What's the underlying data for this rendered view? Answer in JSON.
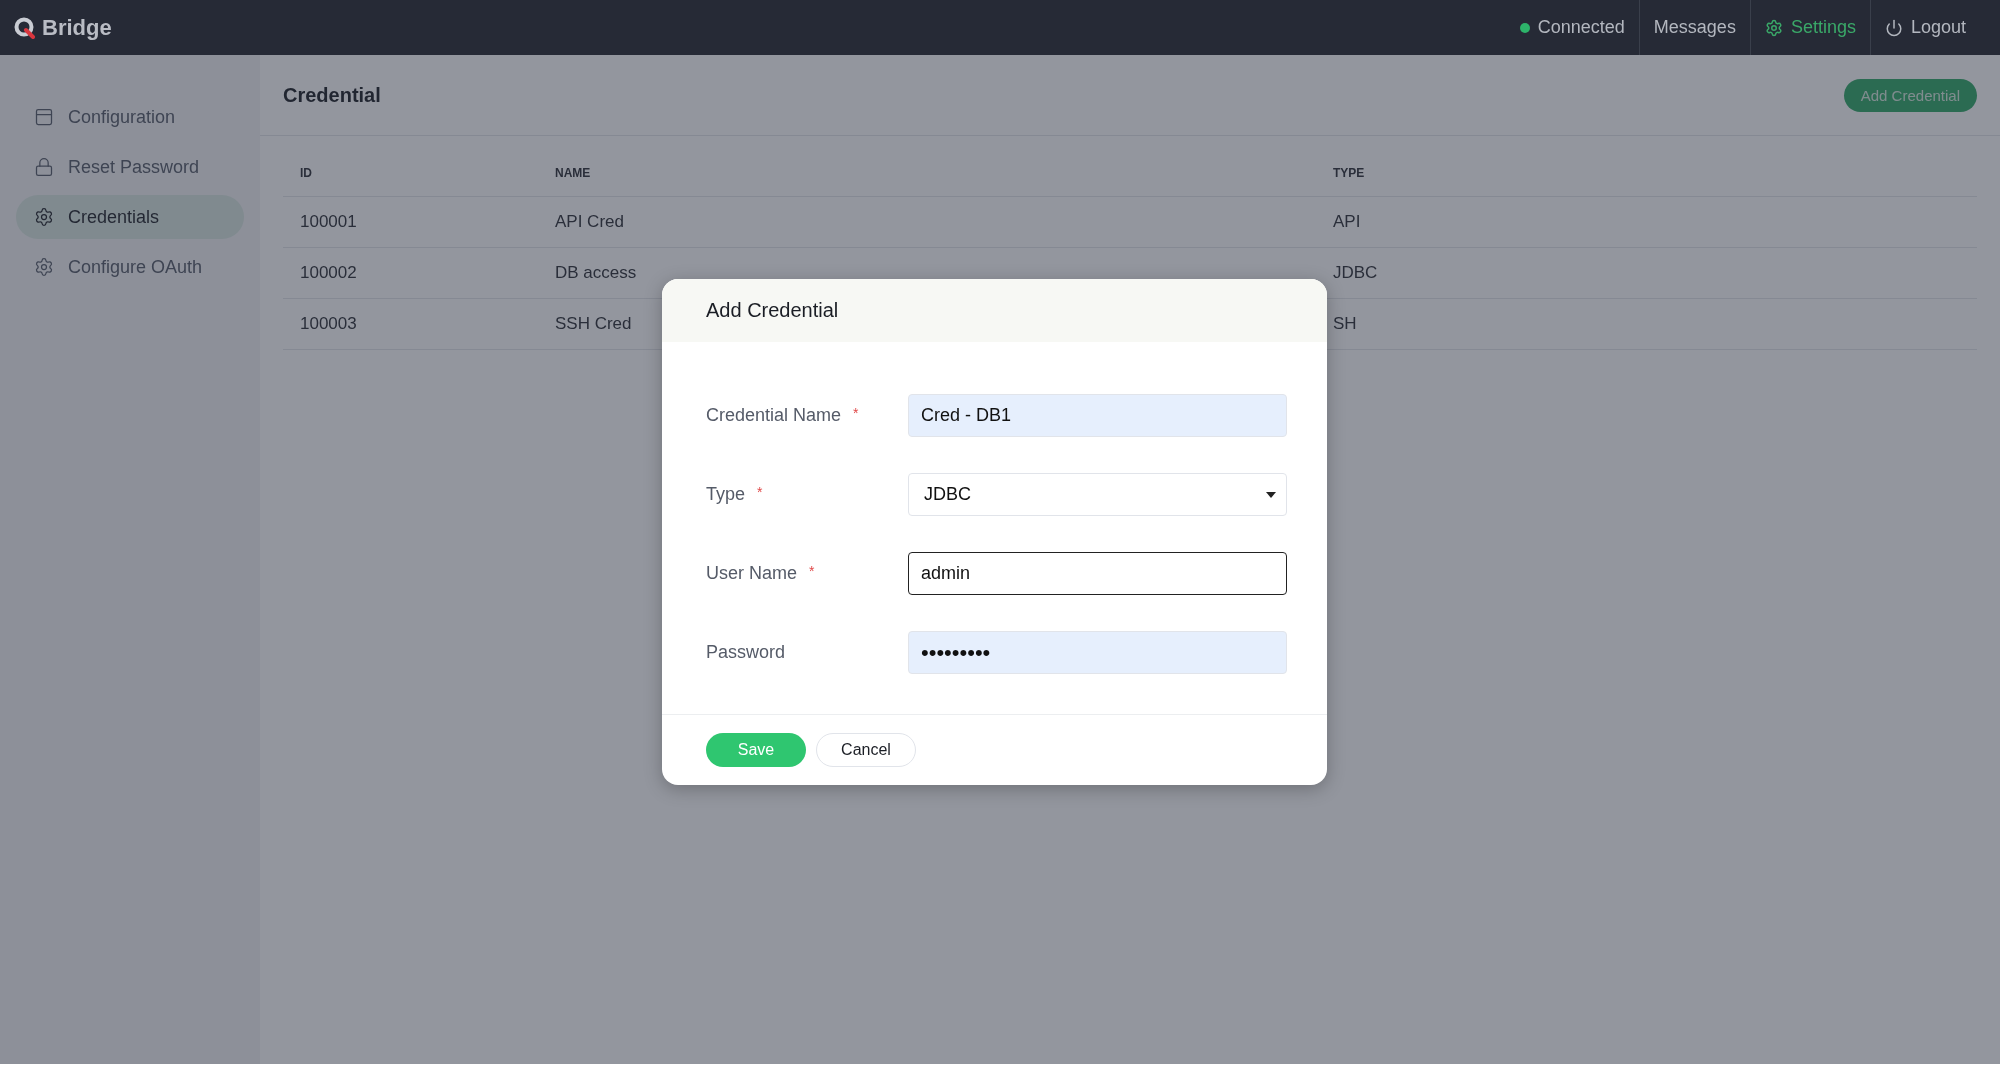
{
  "header": {
    "logo": "Bridge",
    "nav": [
      {
        "kind": "status",
        "label": "Connected",
        "selected": false
      },
      {
        "kind": "link",
        "label": "Messages",
        "selected": false
      },
      {
        "kind": "settings",
        "label": "Settings",
        "selected": true
      },
      {
        "kind": "logout",
        "label": "Logout",
        "selected": false
      }
    ]
  },
  "sidebar": {
    "items": [
      {
        "label": "Configuration",
        "selected": false
      },
      {
        "label": "Reset Password",
        "selected": false
      },
      {
        "label": "Credentials",
        "selected": true
      },
      {
        "label": "Configure OAuth",
        "selected": false
      }
    ]
  },
  "page": {
    "title": "Credential",
    "add_button": "Add Credential"
  },
  "table": {
    "columns": [
      "ID",
      "NAME",
      "TYPE"
    ],
    "rows": [
      [
        "100001",
        "API Cred",
        "API"
      ],
      [
        "100002",
        "DB access",
        "JDBC"
      ],
      [
        "100003",
        "SSH Cred",
        "SH"
      ]
    ]
  },
  "dialog": {
    "title": "Add Credential",
    "fields": [
      {
        "kind": "text",
        "label": "Credential Name",
        "required_mark": "*",
        "value": "Cred - DB1",
        "autofilled": true,
        "focused": false
      },
      {
        "kind": "select",
        "label": "Type",
        "required_mark": "*",
        "value": "JDBC",
        "autofilled": false,
        "focused": false
      },
      {
        "kind": "text",
        "label": "User Name",
        "required_mark": "*",
        "value": "admin",
        "autofilled": false,
        "focused": true
      },
      {
        "kind": "password",
        "label": "Password",
        "value": "•••••••••",
        "autofilled": true,
        "focused": false
      }
    ],
    "buttons": [
      {
        "kind": "primary",
        "label": "Save"
      },
      {
        "kind": "secondary",
        "label": "Cancel"
      }
    ]
  }
}
